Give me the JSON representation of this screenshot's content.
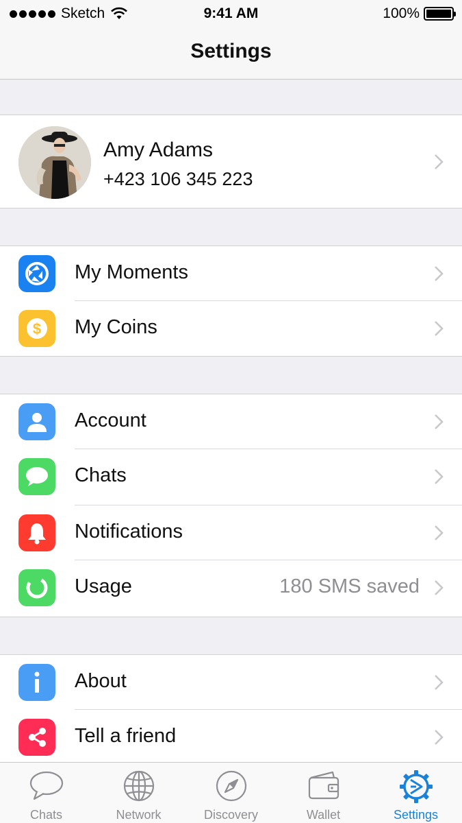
{
  "status_bar": {
    "carrier": "Sketch",
    "time": "9:41 AM",
    "battery": "100%"
  },
  "nav": {
    "title": "Settings"
  },
  "profile": {
    "name": "Amy Adams",
    "phone": "+423 106 345 223"
  },
  "groups": {
    "features": [
      {
        "label": "My Moments",
        "icon": "moments-icon",
        "color": "#1a82f0"
      },
      {
        "label": "My Coins",
        "icon": "coin-icon",
        "color": "#fcc12e"
      }
    ],
    "settings": [
      {
        "label": "Account",
        "icon": "person-icon",
        "color": "#4a9df5"
      },
      {
        "label": "Chats",
        "icon": "chat-bubble-icon",
        "color": "#4cd964"
      },
      {
        "label": "Notifications",
        "icon": "bell-icon",
        "color": "#ff3b30"
      },
      {
        "label": "Usage",
        "icon": "usage-ring-icon",
        "color": "#4cd964",
        "value": "180 SMS saved"
      }
    ],
    "info": [
      {
        "label": "About",
        "icon": "info-icon",
        "color": "#4a9df5"
      },
      {
        "label": "Tell a friend",
        "icon": "share-icon",
        "color": "#ff2d55"
      }
    ]
  },
  "tab_bar": {
    "tabs": [
      {
        "label": "Chats",
        "icon": "chat-tab-icon",
        "active": false
      },
      {
        "label": "Network",
        "icon": "globe-icon",
        "active": false
      },
      {
        "label": "Discovery",
        "icon": "compass-icon",
        "active": false
      },
      {
        "label": "Wallet",
        "icon": "wallet-icon",
        "active": false
      },
      {
        "label": "Settings",
        "icon": "settings-gear-icon",
        "active": true
      }
    ],
    "active_color": "#1a82d8",
    "inactive_color": "#8e8e93"
  }
}
